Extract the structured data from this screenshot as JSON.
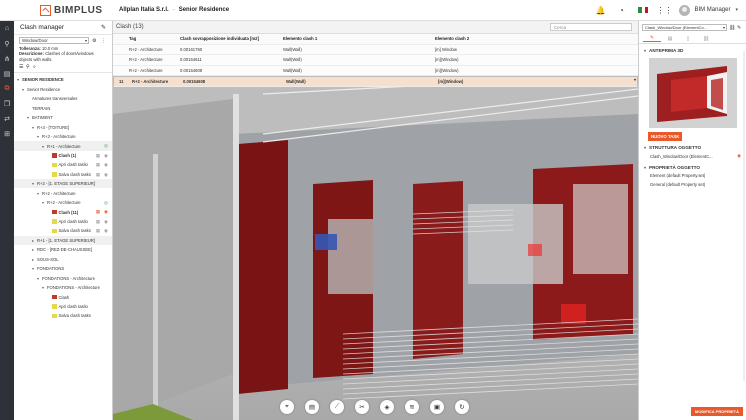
{
  "topbar": {
    "logo_text": "BIMPLUS",
    "company": "Allplan Italia S.r.l.",
    "separator": "-",
    "project": "Senior Residence",
    "user": "BIM Manager"
  },
  "colors": {
    "accent": "#e8592b",
    "selected_row": "#f6e0cd",
    "rail": "#2e3238"
  },
  "left_panel": {
    "title": "Clash manager",
    "filter_select": "Window/Door",
    "tolerance_label": "Tolleranza:",
    "tolerance_value": "10.0 mm",
    "description_label": "Descrizione:",
    "description_value": "Clashes of doors/windows objects with walls.",
    "tree": [
      {
        "label": "SENIOR RESIDENCE",
        "indent": 0,
        "arrow": "▾",
        "bold": true
      },
      {
        "label": "Senior Residence",
        "indent": 1,
        "arrow": "▾"
      },
      {
        "label": "Armatures transversales",
        "indent": 2,
        "arrow": ""
      },
      {
        "label": "TERRAIN",
        "indent": 2,
        "arrow": ""
      },
      {
        "label": "BATIMENT",
        "indent": 2,
        "arrow": "▾"
      },
      {
        "label": "R+3 - [TOITURE]",
        "indent": 3,
        "arrow": "▾"
      },
      {
        "label": "R+3 - Architecture",
        "indent": 4,
        "arrow": "▾"
      },
      {
        "label": "R+1 - Architecture",
        "indent": 5,
        "arrow": "▾",
        "hl": true,
        "actions": [
          "green-check"
        ]
      },
      {
        "label": "Clash (1)",
        "indent": 6,
        "arrow": "",
        "square": "#c0392b",
        "bold": true,
        "actions": [
          "grid",
          "eye"
        ]
      },
      {
        "label": "Apri clash taslio",
        "indent": 6,
        "arrow": "",
        "square": "#e5d84a",
        "actions": [
          "grid",
          "eye"
        ]
      },
      {
        "label": "Salva clash tasks",
        "indent": 6,
        "arrow": "",
        "square": "#e5d84a",
        "actions": [
          "grid",
          "eye"
        ]
      },
      {
        "label": "R+2 - [1. ETAGE SUPERIEUR]",
        "indent": 3,
        "arrow": "▾",
        "hl": true
      },
      {
        "label": "R+2 - Architecture",
        "indent": 4,
        "arrow": "▾"
      },
      {
        "label": "R+2 - Architecture",
        "indent": 5,
        "arrow": "▾",
        "actions": [
          "green-check"
        ]
      },
      {
        "label": "Clash (11)",
        "indent": 6,
        "arrow": "",
        "square": "#c0392b",
        "bold": true,
        "actions": [
          "orange-grid",
          "eye-orange"
        ]
      },
      {
        "label": "Apri clash taslio",
        "indent": 6,
        "arrow": "",
        "square": "#e5d84a",
        "actions": [
          "grid",
          "eye"
        ]
      },
      {
        "label": "Salva clash tasks",
        "indent": 6,
        "arrow": "",
        "square": "#e5d84a",
        "actions": [
          "grid",
          "eye"
        ]
      },
      {
        "label": "R+1 - [1. ETAGE SUPERIEUR]",
        "indent": 3,
        "arrow": "▸",
        "hl": true
      },
      {
        "label": "RDC - [REZ-DE-CHAUSSEE]",
        "indent": 3,
        "arrow": "▸"
      },
      {
        "label": "SOUS-SOL",
        "indent": 3,
        "arrow": "▸"
      },
      {
        "label": "FONDATIONS",
        "indent": 3,
        "arrow": "▾"
      },
      {
        "label": "FONDATIONS - Architecture",
        "indent": 4,
        "arrow": "▾"
      },
      {
        "label": "FONDATIONS - Architecture",
        "indent": 5,
        "arrow": "▾"
      },
      {
        "label": "Clash",
        "indent": 6,
        "arrow": "",
        "square": "#c0392b"
      },
      {
        "label": "Apri clash taslio",
        "indent": 6,
        "arrow": "",
        "square": "#e5d84a"
      },
      {
        "label": "Salva clash tasks",
        "indent": 6,
        "arrow": "",
        "square": "#e5d84a"
      }
    ]
  },
  "main": {
    "title": "Clash (13)",
    "search_placeholder": "Cerca",
    "columns": [
      "Tag",
      "Clash sovrapposizione individuata [m2]",
      "Elemento clash 1",
      "Elemento clash 2"
    ],
    "rows": [
      {
        "n": "",
        "tag": "R+2 - Architecture",
        "overlap": "0.00161760",
        "el1": "Wall(Wall)",
        "el2": "[m] Window"
      },
      {
        "n": "",
        "tag": "R+2 - Architecture",
        "overlap": "0.00154611",
        "el1": "Wall(Wall)",
        "el2": "[m](Window)"
      },
      {
        "n": "",
        "tag": "R+2 - Architecture",
        "overlap": "0.00154608",
        "el1": "Wall(Wall)",
        "el2": "[m](Window)"
      },
      {
        "n": "11",
        "tag": "R+2 - Architecture",
        "overlap": "0.00154608",
        "el1": "Wall(Wall)",
        "el2": "[m](Window)",
        "selected": true
      }
    ]
  },
  "right_panel": {
    "select_value": "Clash_Window/Door (ElementCo...",
    "preview_title": "ANTEPRIMA 3D",
    "new_task": "NUOVO TASK",
    "structure_title": "STRUTTURA OGGETTO",
    "structure_item": "Clash_Window/Door (ElementC...",
    "properties_title": "PROPRIETÀ OGGETTO",
    "properties": [
      "Element (default Property.set)",
      "General (default Property set)"
    ],
    "edit_button": "MODIFICA PROPRIETÀ"
  }
}
